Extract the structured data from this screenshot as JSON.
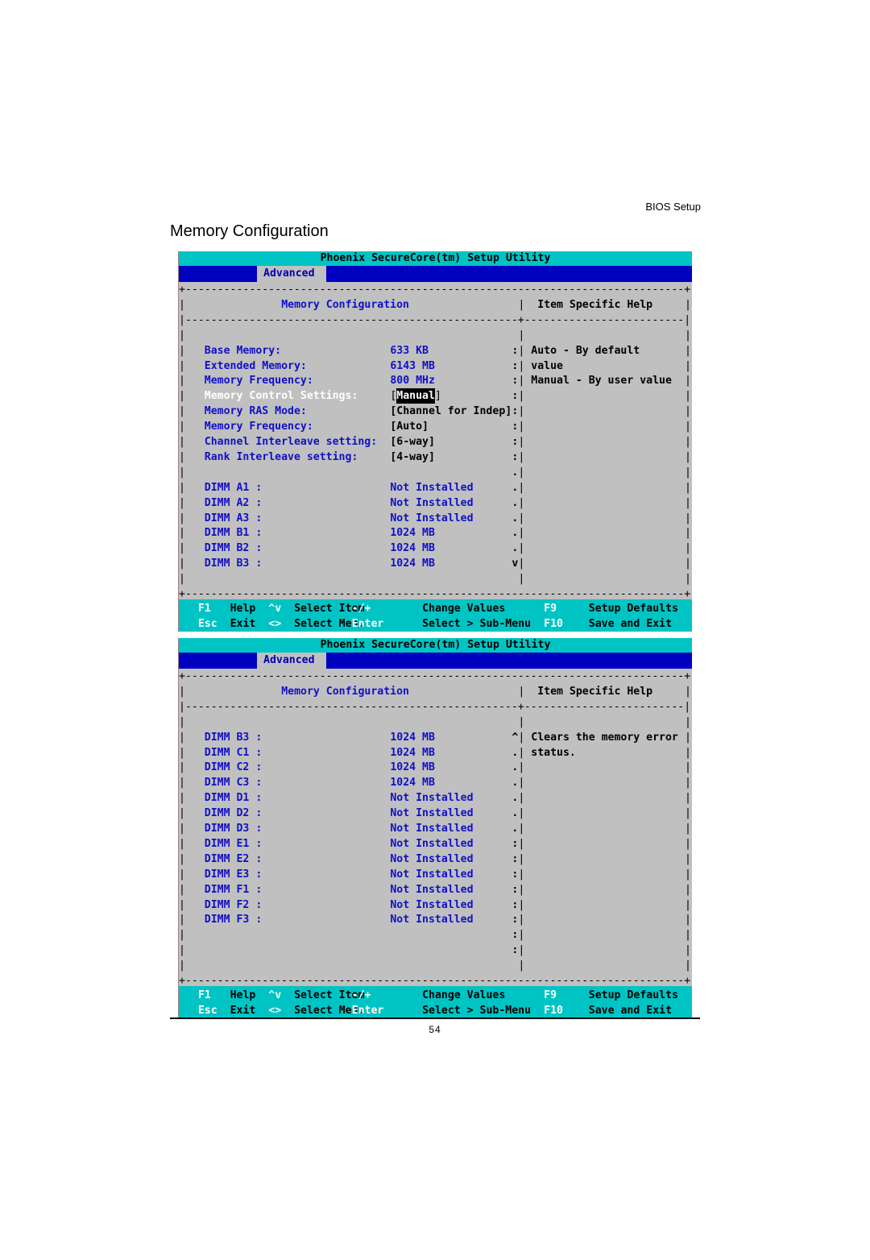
{
  "page": {
    "section_header": "BIOS Setup",
    "title": "Memory Configuration",
    "page_number": "54"
  },
  "screens": [
    {
      "title": "Phoenix SecureCore(tm) Setup Utility",
      "active_tab": "Advanced",
      "panel_title": "Memory Configuration",
      "help_title": "Item Specific Help",
      "help_lines": [
        "Auto - By default",
        "value",
        "Manual - By user value"
      ],
      "items": [
        {
          "label": "Base Memory:",
          "value": "633 KB",
          "marker": ":"
        },
        {
          "label": "Extended Memory:",
          "value": "6143 MB",
          "marker": ":"
        },
        {
          "label": "Memory Frequency:",
          "value": "800 MHz",
          "marker": ":"
        },
        {
          "label": "Memory Control Settings:",
          "value": "Manual",
          "marker": ":",
          "selected": true,
          "bracketed": true
        },
        {
          "label": "Memory RAS Mode:",
          "value": "[Channel for Indep]",
          "marker": ":"
        },
        {
          "label": "Memory Frequency:",
          "value": "[Auto]",
          "marker": ":"
        },
        {
          "label": "Channel Interleave setting:",
          "value": "[6-way]",
          "marker": ":"
        },
        {
          "label": "Rank Interleave setting:",
          "value": "[4-way]",
          "marker": ":"
        },
        {
          "label": "",
          "value": "",
          "marker": "."
        },
        {
          "label": "DIMM A1 :",
          "value": "Not Installed",
          "marker": "."
        },
        {
          "label": "DIMM A2 :",
          "value": "Not Installed",
          "marker": "."
        },
        {
          "label": "DIMM A3 :",
          "value": "Not Installed",
          "marker": "."
        },
        {
          "label": "DIMM B1 :",
          "value": "1024 MB",
          "marker": "."
        },
        {
          "label": "DIMM B2 :",
          "value": "1024 MB",
          "marker": "."
        },
        {
          "label": "DIMM B3 :",
          "value": "1024 MB",
          "marker": "v"
        }
      ],
      "footer": [
        [
          [
            "F1",
            "Help"
          ],
          [
            "^v",
            "Select Item"
          ],
          [
            "-/+",
            "Change Values"
          ],
          [
            "F9",
            "Setup Defaults"
          ]
        ],
        [
          [
            "Esc",
            "Exit"
          ],
          [
            "<>",
            "Select Menu"
          ],
          [
            "Enter",
            "Select > Sub-Menu"
          ],
          [
            "F10",
            "Save and Exit"
          ]
        ]
      ]
    },
    {
      "title": "Phoenix SecureCore(tm) Setup Utility",
      "active_tab": "Advanced",
      "panel_title": "Memory Configuration",
      "help_title": "Item Specific Help",
      "help_lines": [
        "Clears the memory error",
        "status."
      ],
      "items": [
        {
          "label": "DIMM B3 :",
          "value": "1024 MB",
          "marker": "^"
        },
        {
          "label": "DIMM C1 :",
          "value": "1024 MB",
          "marker": "."
        },
        {
          "label": "DIMM C2 :",
          "value": "1024 MB",
          "marker": "."
        },
        {
          "label": "DIMM C3 :",
          "value": "1024 MB",
          "marker": "."
        },
        {
          "label": "DIMM D1 :",
          "value": "Not Installed",
          "marker": "."
        },
        {
          "label": "DIMM D2 :",
          "value": "Not Installed",
          "marker": "."
        },
        {
          "label": "DIMM D3 :",
          "value": "Not Installed",
          "marker": "."
        },
        {
          "label": "DIMM E1 :",
          "value": "Not Installed",
          "marker": ":"
        },
        {
          "label": "DIMM E2 :",
          "value": "Not Installed",
          "marker": ":"
        },
        {
          "label": "DIMM E3 :",
          "value": "Not Installed",
          "marker": ":"
        },
        {
          "label": "DIMM F1 :",
          "value": "Not Installed",
          "marker": ":"
        },
        {
          "label": "DIMM F2 :",
          "value": "Not Installed",
          "marker": ":"
        },
        {
          "label": "DIMM F3 :",
          "value": "Not Installed",
          "marker": ":"
        },
        {
          "label": "",
          "value": "",
          "marker": ":"
        },
        {
          "label": "",
          "value": "",
          "marker": ":"
        }
      ],
      "footer": [
        [
          [
            "F1",
            "Help"
          ],
          [
            "^v",
            "Select Item"
          ],
          [
            "-/+",
            "Change Values"
          ],
          [
            "F9",
            "Setup Defaults"
          ]
        ],
        [
          [
            "Esc",
            "Exit"
          ],
          [
            "<>",
            "Select Menu"
          ],
          [
            "Enter",
            "Select > Sub-Menu"
          ],
          [
            "F10",
            "Save and Exit"
          ]
        ]
      ]
    }
  ],
  "colors": {
    "title_bar": "#00c4c4",
    "menu_bar": "#0000c0",
    "panel_bg": "#c0c0c0",
    "item_text": "#1010c8",
    "selected_text": "#ffffff",
    "footer_key": "#ffffff"
  }
}
